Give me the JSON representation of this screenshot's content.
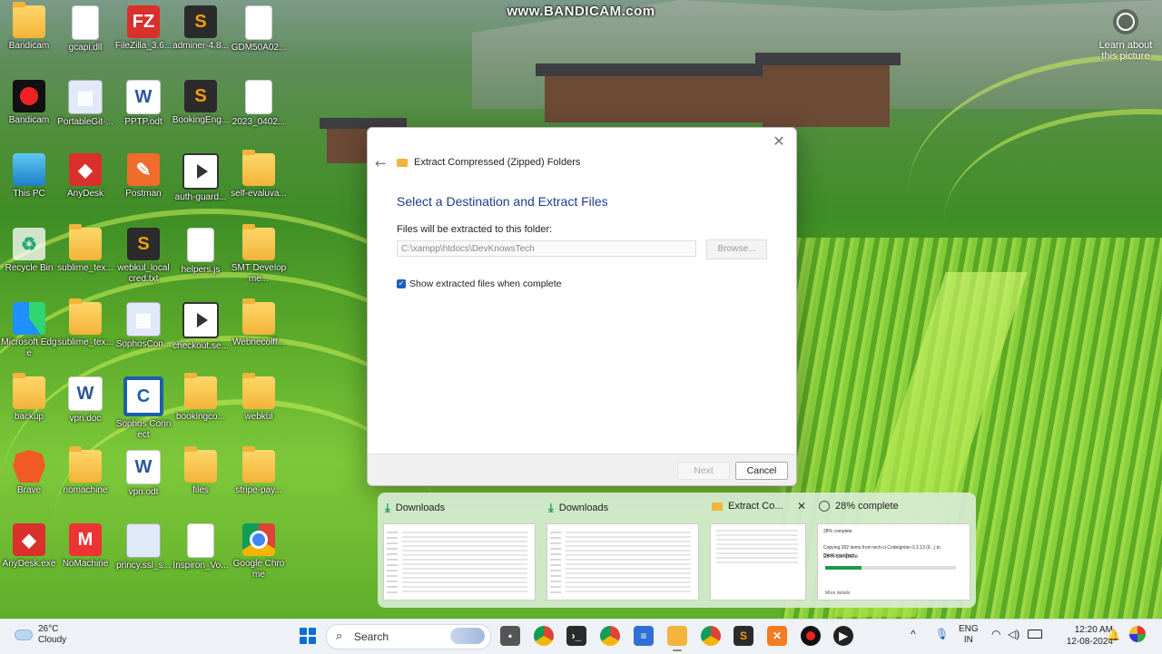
{
  "watermark": "www.BANDICAM.com",
  "learn_more": "Learn about this picture",
  "desktop_icons": [
    {
      "label": "Bandicam",
      "icon": "folder-icon"
    },
    {
      "label": "gcapi.dll",
      "icon": "gear-file-icon"
    },
    {
      "label": "FileZilla_3.6...",
      "icon": "filezilla-icon"
    },
    {
      "label": "adminer-4.8...",
      "icon": "sublime-icon"
    },
    {
      "label": "GDM50A02...",
      "icon": "document-icon"
    },
    {
      "label": "Bandicam",
      "icon": "record-icon"
    },
    {
      "label": "PortableGit-...",
      "icon": "installer-icon"
    },
    {
      "label": "PPTP.odt",
      "icon": "word-icon"
    },
    {
      "label": "BookingEng...",
      "icon": "sublime-icon"
    },
    {
      "label": "2023_0402...",
      "icon": "document-icon"
    },
    {
      "label": "This PC",
      "icon": "computer-icon"
    },
    {
      "label": "AnyDesk",
      "icon": "anydesk-icon"
    },
    {
      "label": "Postman",
      "icon": "postman-icon"
    },
    {
      "label": "auth-guard...",
      "icon": "video-icon"
    },
    {
      "label": "self-evaluva...",
      "icon": "chrome-folder-icon"
    },
    {
      "label": "Recycle Bin",
      "icon": "recycle-bin-icon"
    },
    {
      "label": "sublime_tex...",
      "icon": "folder-icon"
    },
    {
      "label": "webkul_local cred.txt",
      "icon": "sublime-icon"
    },
    {
      "label": "helpers.js",
      "icon": "document-icon"
    },
    {
      "label": "SMT Developme...",
      "icon": "folder-icon"
    },
    {
      "label": "Microsoft Edge",
      "icon": "edge-icon"
    },
    {
      "label": "sublime_tex...",
      "icon": "folder-icon"
    },
    {
      "label": "SophosCon...",
      "icon": "installer-icon"
    },
    {
      "label": "checkout.se...",
      "icon": "video-icon"
    },
    {
      "label": "Webnecolff...",
      "icon": "chrome-folder-icon"
    },
    {
      "label": "backup",
      "icon": "folder-icon"
    },
    {
      "label": "vpn.doc",
      "icon": "word-icon"
    },
    {
      "label": "Sophos Connect",
      "icon": "sophos-icon"
    },
    {
      "label": "bookingco...",
      "icon": "folder-icon"
    },
    {
      "label": "webkul",
      "icon": "folder-icon"
    },
    {
      "label": "Brave",
      "icon": "brave-icon"
    },
    {
      "label": "nomachine",
      "icon": "folder-icon"
    },
    {
      "label": "vpn.odt",
      "icon": "word-icon"
    },
    {
      "label": "files",
      "icon": "folder-icon"
    },
    {
      "label": "stripe-pay...",
      "icon": "folder-icon"
    },
    {
      "label": "AnyDesk.exe",
      "icon": "anydesk-icon"
    },
    {
      "label": "NoMachine",
      "icon": "nomachine-icon"
    },
    {
      "label": "princy.ssl_s...",
      "icon": "certificate-icon"
    },
    {
      "label": "Inspiron_Vo...",
      "icon": "document-icon"
    },
    {
      "label": "Google Chrome",
      "icon": "chrome-icon"
    }
  ],
  "dialog": {
    "title": "Extract Compressed (Zipped) Folders",
    "heading": "Select a Destination and Extract Files",
    "path_label": "Files will be extracted to this folder:",
    "path_value": "C:\\xampp\\htdocs\\DevKnowsTech",
    "browse_label": "Browse...",
    "checkbox_label": "Show extracted files when complete",
    "checkbox_checked": true,
    "next_label": "Next",
    "cancel_label": "Cancel"
  },
  "switcher": {
    "thumbs": [
      {
        "caption": "Downloads"
      },
      {
        "caption": "Downloads"
      },
      {
        "caption": "Extract Co..."
      },
      {
        "caption": "28% complete"
      }
    ],
    "copy_preview": {
      "title": "28% complete",
      "line": "Copying 202 items from tech-ci CodeIgniter-3.1.13 (9...) to DevKnowsTech",
      "percent_text": "28% complete",
      "progress": 0.28,
      "more": "More details"
    }
  },
  "taskbar": {
    "temperature": "26°C",
    "weather": "Cloudy",
    "search_placeholder": "Search",
    "language_top": "ENG",
    "language_bottom": "IN",
    "time": "12:20 AM",
    "date": "12-08-2024",
    "apps": [
      "file-explorer-icon",
      "chrome-icon",
      "terminal-icon",
      "chrome-icon",
      "notepad-icon",
      "folder-icon",
      "chrome-icon",
      "sublime-icon",
      "xampp-icon",
      "bandicam-icon",
      "media-player-icon"
    ]
  }
}
